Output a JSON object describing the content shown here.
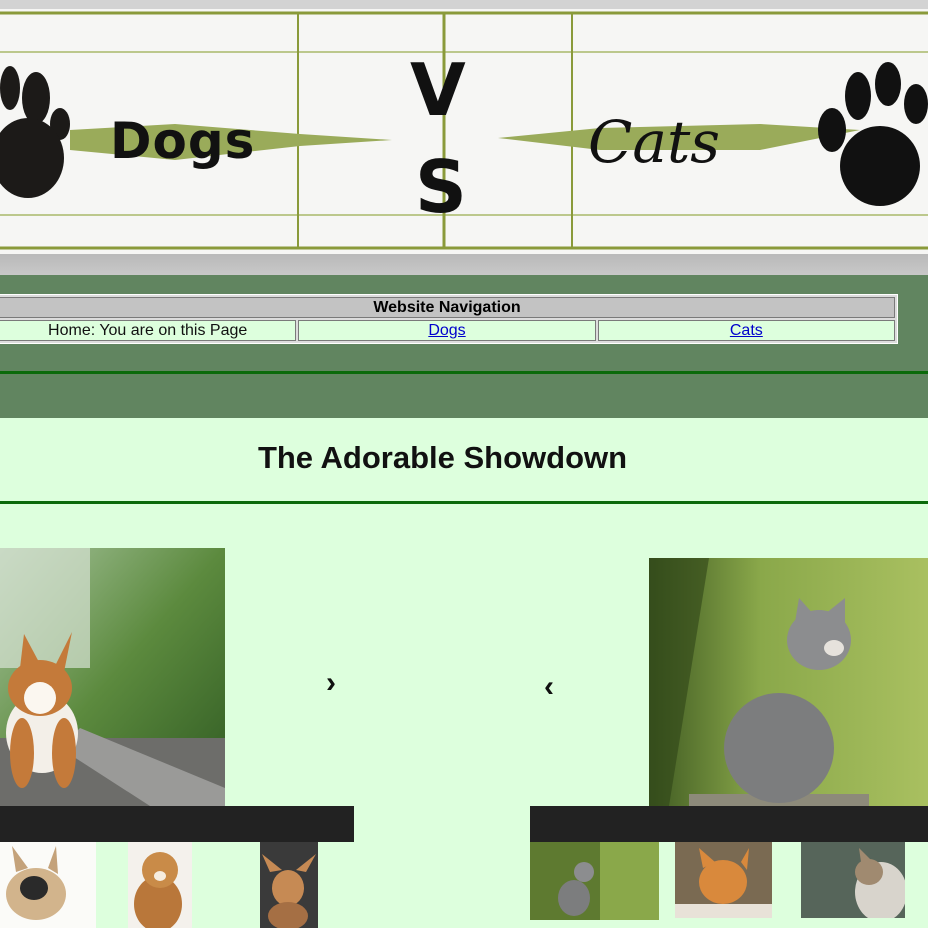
{
  "banner": {
    "left_word": "Dogs",
    "v_letter": "V",
    "s_letter": "S",
    "right_word": "Cats",
    "accent_color": "#8a9a3a",
    "leaf_color": "#9aab5a"
  },
  "nav": {
    "heading": "Website Navigation",
    "home_label": "Home: You are on this Page",
    "dogs_link": "Dogs",
    "cats_link": "Cats",
    "band_color": "#618560",
    "line_color": "#0a6a0a"
  },
  "main": {
    "title": "The Adorable Showdown",
    "background": "#ddffdd"
  },
  "slideshow": {
    "next_arrow": "›",
    "prev_arrow": "‹",
    "bar_color": "#222222"
  }
}
